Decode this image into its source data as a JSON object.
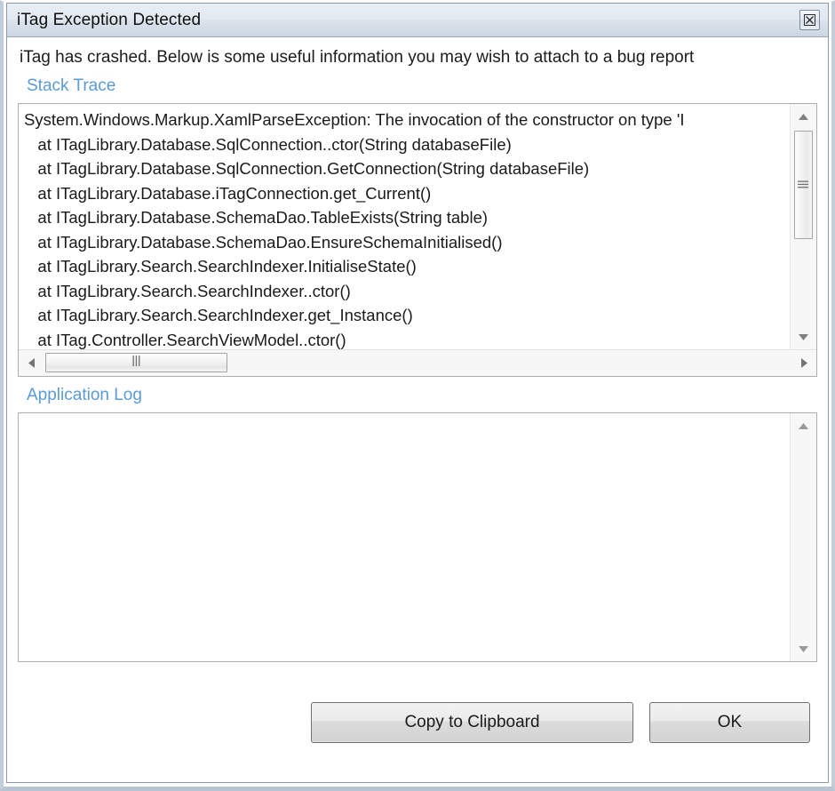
{
  "window": {
    "title": "iTag Exception Detected",
    "close_icon": "close-icon",
    "close_glyph": "☒"
  },
  "message": "iTag has crashed. Below is some useful information you may wish to attach to a bug report",
  "stack_trace": {
    "label": "Stack Trace",
    "lines": [
      "System.Windows.Markup.XamlParseException: The invocation of the constructor on type 'I",
      "   at ITagLibrary.Database.SqlConnection..ctor(String databaseFile)",
      "   at ITagLibrary.Database.SqlConnection.GetConnection(String databaseFile)",
      "   at ITagLibrary.Database.iTagConnection.get_Current()",
      "   at ITagLibrary.Database.SchemaDao.TableExists(String table)",
      "   at ITagLibrary.Database.SchemaDao.EnsureSchemaInitialised()",
      "   at ITagLibrary.Search.SearchIndexer.InitialiseState()",
      "   at ITagLibrary.Search.SearchIndexer..ctor()",
      "   at ITagLibrary.Search.SearchIndexer.get_Instance()",
      "   at ITag.Controller.SearchViewModel..ctor()"
    ],
    "vscroll": {
      "up_icon": "scroll-up-arrow-icon",
      "down_icon": "scroll-down-arrow-icon",
      "thumb_icon": "scroll-thumb-grip-icon"
    },
    "hscroll": {
      "left_icon": "scroll-left-arrow-icon",
      "right_icon": "scroll-right-arrow-icon",
      "thumb_icon": "scroll-thumb-grip-icon"
    }
  },
  "application_log": {
    "label": "Application Log",
    "content": "",
    "vscroll": {
      "up_icon": "scroll-up-arrow-icon",
      "down_icon": "scroll-down-arrow-icon"
    }
  },
  "buttons": {
    "copy": "Copy to Clipboard",
    "ok": "OK"
  },
  "colors": {
    "link": "#5b9bd5",
    "titlebar_top": "#e9eef5",
    "titlebar_bottom": "#ccd6e2",
    "border": "#8a99ab",
    "text": "#1a1a1a"
  }
}
